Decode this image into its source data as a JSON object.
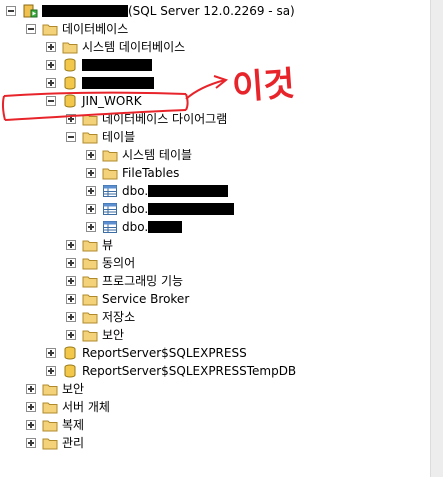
{
  "server": {
    "label": "(SQL Server 12.0.2269 - sa)"
  },
  "nodes": {
    "databases": "데이터베이스",
    "system_databases": "시스템 데이터베이스",
    "jin_work": "JIN_WORK",
    "diagrams": "데이터베이스 다이어그램",
    "tables": "테이블",
    "system_tables": "시스템 테이블",
    "filetables": "FileTables",
    "dbo_prefix": "dbo.",
    "views": "뷰",
    "synonyms": "동의어",
    "programmability": "프로그래밍 기능",
    "service_broker": "Service Broker",
    "storage": "저장소",
    "db_security": "보안",
    "report_server": "ReportServer$SQLEXPRESS",
    "report_server_temp": "ReportServer$SQLEXPRESSTempDB",
    "security": "보안",
    "server_objects": "서버 개체",
    "replication": "복제",
    "management": "관리"
  },
  "annotation": {
    "text": "이것",
    "color": "#e8242b"
  }
}
